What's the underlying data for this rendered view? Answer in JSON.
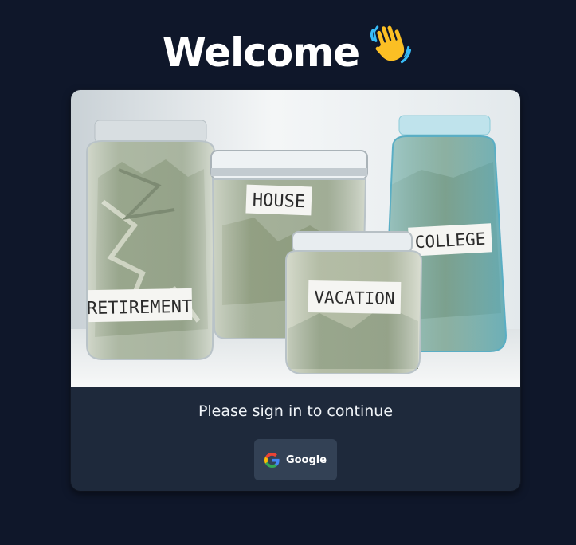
{
  "header": {
    "title": "Welcome",
    "emoji": "👋"
  },
  "hero": {
    "jar_labels": [
      "RETIREMENT",
      "HOUSE",
      "VACATION",
      "COLLEGE"
    ]
  },
  "signin": {
    "prompt": "Please sign in to continue",
    "google_label": "Google",
    "google_icon": "google-g-icon"
  },
  "colors": {
    "page_bg": "#0f172a",
    "card_bg": "#1e293b",
    "button_bg": "#334155",
    "text": "#ffffff",
    "google_blue": "#4285F4",
    "google_red": "#EA4335",
    "google_yellow": "#FBBC05",
    "google_green": "#34A853",
    "jar_glass": "#dfe6ea",
    "blue_jar": "#7fc4d4",
    "money_green": "#8d9a78"
  }
}
